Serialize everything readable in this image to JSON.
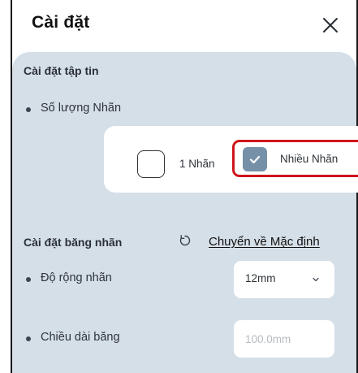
{
  "header": {
    "title": "Cài đặt",
    "close_icon": "close-icon"
  },
  "file_settings": {
    "section_title": "Cài đặt tập tin",
    "label_count_label": "Số lượng Nhãn",
    "options": [
      {
        "label": "1 Nhãn",
        "checked": false
      },
      {
        "label": "Nhiều Nhãn",
        "checked": true
      }
    ]
  },
  "tape_settings": {
    "section_title": "Cài đặt băng nhãn",
    "reset_icon": "reset-icon",
    "reset_label": "Chuyển về Mặc định",
    "label_width": {
      "label": "Độ rộng nhãn",
      "value": "12mm",
      "chevron_icon": "chevron-down-icon"
    },
    "tape_length": {
      "label": "Chiều dài băng",
      "value": "",
      "placeholder": "100.0mm"
    }
  },
  "colors": {
    "panel_background": "#d5dfe8",
    "checked_accent": "#7690a8",
    "highlight_outline": "#d0151c"
  }
}
